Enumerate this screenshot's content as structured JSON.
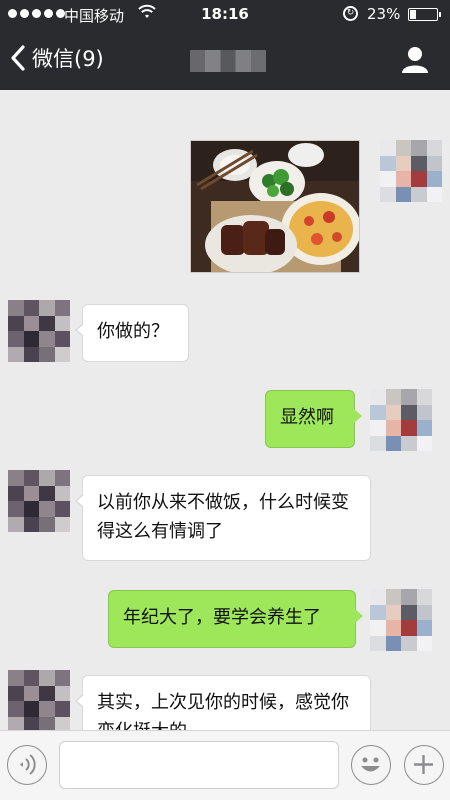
{
  "status_bar": {
    "carrier": "中国移动",
    "time": "18:16",
    "battery_percent_text": "23%",
    "battery_level": 0.23
  },
  "nav": {
    "back_label": "微信(9)",
    "back_icon": "chevron-left-icon",
    "profile_icon": "person-icon"
  },
  "messages": [
    {
      "side": "out",
      "kind": "image",
      "content": "food-photo"
    },
    {
      "side": "in",
      "text": "你做的？"
    },
    {
      "side": "out",
      "text": "显然啊"
    },
    {
      "side": "in",
      "text": "以前你从来不做饭，什么时候变得这么有情调了"
    },
    {
      "side": "out",
      "text": "年纪大了，要学会养生了"
    },
    {
      "side": "in",
      "text": "其实，上次见你的时候，感觉你变化挺大的"
    }
  ],
  "input_bar": {
    "voice_icon": "voice-icon",
    "emoji_icon": "emoji-icon",
    "more_icon": "plus-icon",
    "text_value": ""
  },
  "colors": {
    "nav_bg": "#2a2b2f",
    "chat_bg": "#ebebeb",
    "outgoing_bubble": "#9ee65a",
    "incoming_bubble": "#ffffff"
  }
}
